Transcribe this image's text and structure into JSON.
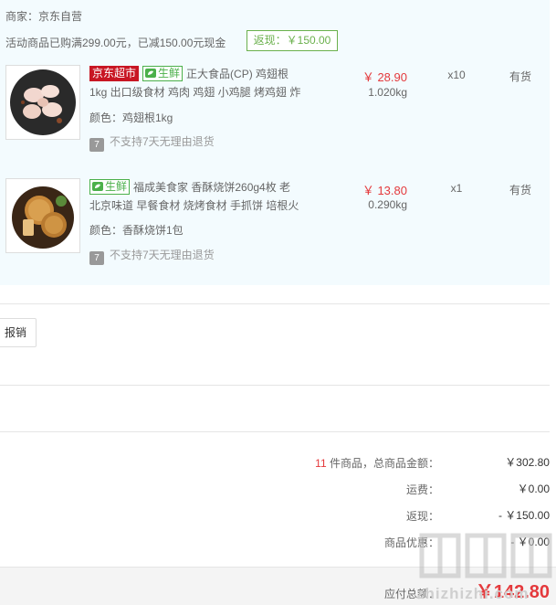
{
  "order": {
    "merchant_label": "商家：京东自营",
    "promo_text": "活动商品已购满299.00元，已减150.00元现金",
    "rebate_badge": "返现：￥150.00"
  },
  "items": [
    {
      "tags": [
        "京东超市",
        "生鲜"
      ],
      "title_line1": "正大食品(CP) 鸡翅根",
      "title_line2": "1kg 出口级食材 鸡肉 鸡翅 小鸡腿 烤鸡翅 炸",
      "spec": "颜色：鸡翅根1kg",
      "return_note": "不支持7天无理由退货",
      "price": "￥ 28.90",
      "weight": "1.020kg",
      "qty": "x10",
      "stock": "有货"
    },
    {
      "tags": [
        "生鲜"
      ],
      "title_line1": "福成美食家 香酥烧饼260g4枚 老",
      "title_line2": "北京味道 早餐食材 烧烤食材 手抓饼 培根火",
      "spec": "颜色：香酥烧饼1包",
      "return_note": "不支持7天无理由退货",
      "price": "￥ 13.80",
      "weight": "0.290kg",
      "qty": "x1",
      "stock": "有货"
    }
  ],
  "report_button": "报销",
  "summary": {
    "count": "11",
    "count_suffix": "件商品，总商品金额：",
    "total_value": "￥302.80",
    "shipping_label": "运费：",
    "shipping_value": "￥0.00",
    "rebate_label": "返现：",
    "rebate_value": "- ￥150.00",
    "discount_label": "商品优惠：",
    "discount_value": "- ￥0.00",
    "payable_label": "应付总额：",
    "payable_value": "￥142.80"
  },
  "watermark": "zhizhizhi.com",
  "colors": {
    "accent_red": "#e4393c",
    "fresh_green": "#4bb04a",
    "jd_red": "#c81623"
  }
}
